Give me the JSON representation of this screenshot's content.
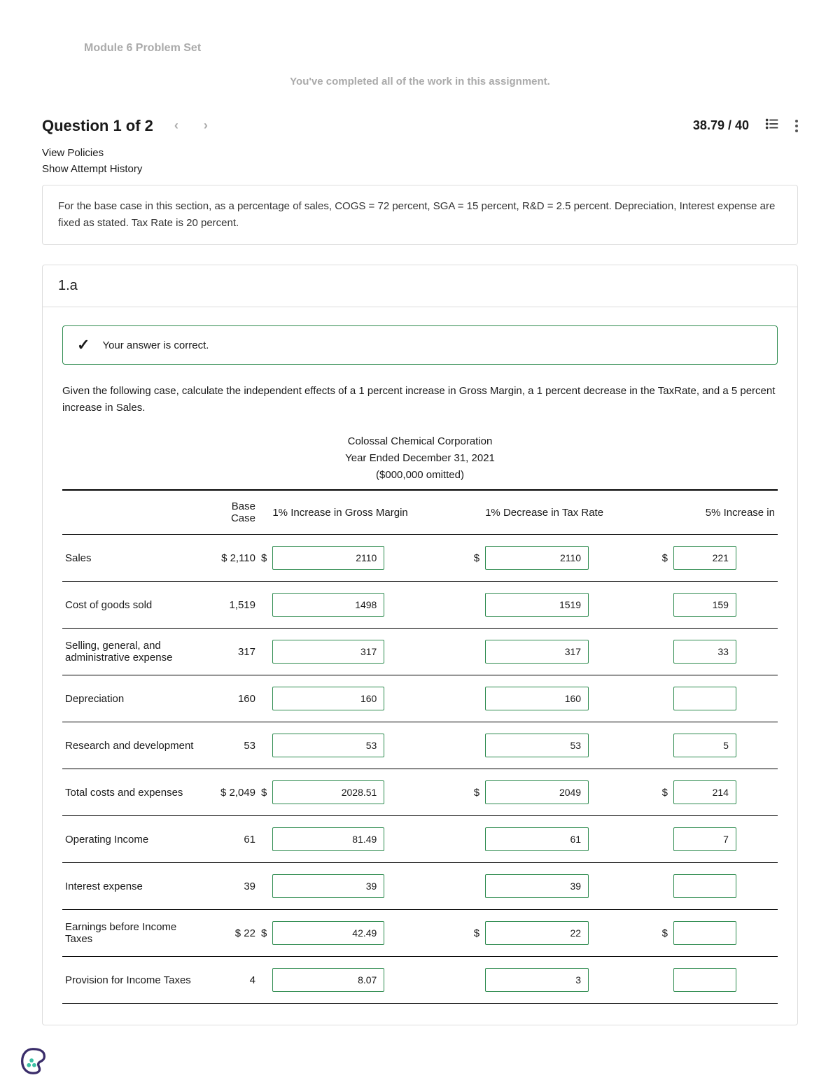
{
  "header": {
    "module_title": "Module 6 Problem Set",
    "completed_msg": "You've completed all of the work in this assignment.",
    "question_label": "Question 1 of 2",
    "score": "38.79 / 40"
  },
  "links": {
    "view_policies": "View Policies",
    "show_history": "Show Attempt History"
  },
  "statement": "For the base case in this section, as a percentage of sales, COGS = 72 percent, SGA = 15 percent, R&D = 2.5 percent. Depreciation, Interest expense are fixed as stated. Tax Rate is 20 percent.",
  "part": {
    "label": "1.a",
    "feedback": "Your answer is correct.",
    "prompt": "Given the following case, calculate the independent effects of a 1 percent increase in Gross Margin, a 1 percent decrease in the TaxRate, and a 5 percent increase in Sales.",
    "table_title": {
      "l1": "Colossal Chemical Corporation",
      "l2": "Year Ended December 31, 2021",
      "l3": "($000,000 omitted)"
    },
    "columns": {
      "base": "Base Case",
      "gm": "1% Increase in Gross Margin",
      "tr": "1% Decrease in Tax Rate",
      "si": "5% Increase in"
    },
    "rows": [
      {
        "label": "Sales",
        "base_prefix": "$",
        "base": "2,110",
        "gm_prefix": "$",
        "gm": "2110",
        "tr_prefix": "$",
        "tr": "2110",
        "si_prefix": "$",
        "si": "221"
      },
      {
        "label": "Cost of goods sold",
        "base_prefix": "",
        "base": "1,519",
        "gm_prefix": "",
        "gm": "1498",
        "tr_prefix": "",
        "tr": "1519",
        "si_prefix": "",
        "si": "159"
      },
      {
        "label": "Selling, general, and administrative expense",
        "base_prefix": "",
        "base": "317",
        "gm_prefix": "",
        "gm": "317",
        "tr_prefix": "",
        "tr": "317",
        "si_prefix": "",
        "si": "33"
      },
      {
        "label": "Depreciation",
        "base_prefix": "",
        "base": "160",
        "gm_prefix": "",
        "gm": "160",
        "tr_prefix": "",
        "tr": "160",
        "si_prefix": "",
        "si": ""
      },
      {
        "label": "Research and development",
        "base_prefix": "",
        "base": "53",
        "gm_prefix": "",
        "gm": "53",
        "tr_prefix": "",
        "tr": "53",
        "si_prefix": "",
        "si": "5"
      },
      {
        "label": "Total costs and expenses",
        "base_prefix": "$",
        "base": "2,049",
        "gm_prefix": "$",
        "gm": "2028.51",
        "tr_prefix": "$",
        "tr": "2049",
        "si_prefix": "$",
        "si": "214"
      },
      {
        "label": "Operating Income",
        "base_prefix": "",
        "base": "61",
        "gm_prefix": "",
        "gm": "81.49",
        "tr_prefix": "",
        "tr": "61",
        "si_prefix": "",
        "si": "7"
      },
      {
        "label": "Interest expense",
        "base_prefix": "",
        "base": "39",
        "gm_prefix": "",
        "gm": "39",
        "tr_prefix": "",
        "tr": "39",
        "si_prefix": "",
        "si": ""
      },
      {
        "label": "Earnings before Income Taxes",
        "base_prefix": "$",
        "base": "22",
        "gm_prefix": "$",
        "gm": "42.49",
        "tr_prefix": "$",
        "tr": "22",
        "si_prefix": "$",
        "si": ""
      },
      {
        "label": "Provision for Income Taxes",
        "base_prefix": "",
        "base": "4",
        "gm_prefix": "",
        "gm": "8.07",
        "tr_prefix": "",
        "tr": "3",
        "si_prefix": "",
        "si": ""
      }
    ]
  }
}
